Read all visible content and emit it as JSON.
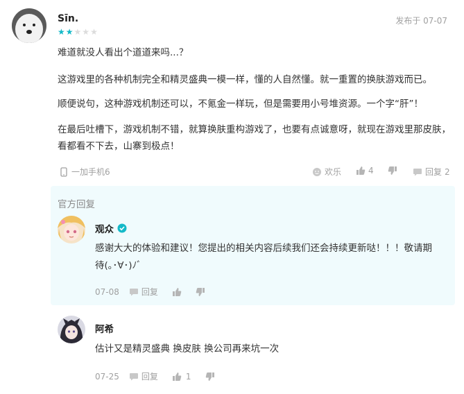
{
  "review": {
    "username": "Sīn.",
    "posted_at": "发布于 07-07",
    "rating": 2,
    "rating_max": 5,
    "paragraphs": [
      "难道就没人看出个道道来吗...？",
      "这游戏里的各种机制完全和精灵盛典一模一样，懂的人自然懂。就一重置的换肤游戏而已。",
      "顺便说句，这种游戏机制还可以，不氪金一样玩，但是需要用小号堆资源。一个字“肝”！",
      "在最后吐槽下，游戏机制不错，就算换肤重构游戏了，也要有点诚意呀，就现在游戏里那皮肤，看都看不下去，山寨到极点！"
    ],
    "device": "一加手机6",
    "funny_label": "欢乐",
    "like_count": "4",
    "reply_label": "回复",
    "reply_count": "2"
  },
  "official_reply": {
    "heading": "官方回复",
    "name": "观众",
    "text_line1": "感谢大大的体验和建议！您提出的相关内容后续我们还会持续更新哒！！！敬请期",
    "text_line2": "待(｡･∀･)ﾉﾞ",
    "date": "07-08",
    "reply_label": "回复"
  },
  "user_reply": {
    "name": "阿希",
    "text": "估计又是精灵盛典 换皮肤 换公司再来坑一次",
    "date": "07-25",
    "reply_label": "回复",
    "like_count": "1"
  },
  "colors": {
    "accent": "#14b9c8",
    "muted": "#a0a0a0",
    "reply_bg": "#f0fbfd"
  }
}
